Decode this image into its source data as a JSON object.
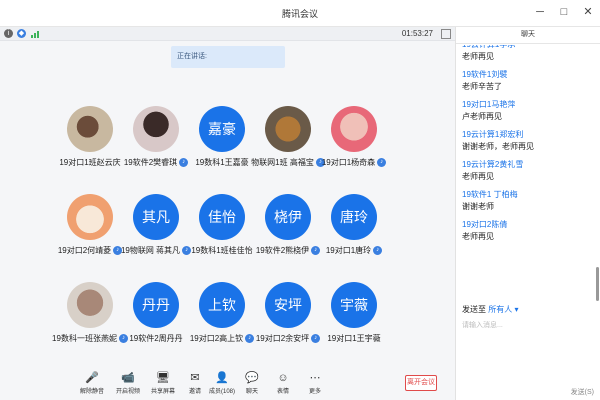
{
  "window": {
    "title": "腾讯会议",
    "controls": [
      "─",
      "□",
      "✕"
    ]
  },
  "infobar": {
    "timer": "01:53:27"
  },
  "speaking_label": "正在讲话:",
  "participants": [
    [
      {
        "name": "19对口1班赵云庆",
        "avatar": "",
        "photo": "p1",
        "mic": false
      },
      {
        "name": "19软件2樊睿琪",
        "avatar": "",
        "photo": "p2",
        "mic": true
      },
      {
        "name": "19数科1王嘉豪",
        "avatar": "嘉豪",
        "photo": "",
        "mic": false
      },
      {
        "name": "物联网1班 高福宝",
        "avatar": "",
        "photo": "p3",
        "mic": true
      },
      {
        "name": "19对口1杨奇森",
        "avatar": "",
        "photo": "p4",
        "mic": true
      }
    ],
    [
      {
        "name": "19对口2何靖菱",
        "avatar": "",
        "photo": "p5",
        "mic": true
      },
      {
        "name": "19物联网 蒋其凡",
        "avatar": "其凡",
        "photo": "",
        "mic": true
      },
      {
        "name": "19数科1班桂佳怡",
        "avatar": "佳怡",
        "photo": "",
        "mic": false
      },
      {
        "name": "19软件2熊桡伊",
        "avatar": "桡伊",
        "photo": "",
        "mic": true
      },
      {
        "name": "19对口1唐玲",
        "avatar": "唐玲",
        "photo": "",
        "mic": true
      }
    ],
    [
      {
        "name": "19数科一班张燕妮",
        "avatar": "",
        "photo": "p6",
        "mic": true
      },
      {
        "name": "19软件2周丹丹",
        "avatar": "丹丹",
        "photo": "",
        "mic": false
      },
      {
        "name": "19对口2高上钦",
        "avatar": "上钦",
        "photo": "",
        "mic": true
      },
      {
        "name": "19对口2余安坪",
        "avatar": "安坪",
        "photo": "",
        "mic": true
      },
      {
        "name": "19对口1王宇薇",
        "avatar": "宇薇",
        "photo": "",
        "mic": false
      }
    ]
  ],
  "toolbar": [
    {
      "icon": "🎤",
      "label": "解除静音",
      "name": "unmute"
    },
    {
      "icon": "📹",
      "label": "开启视频",
      "name": "start-video"
    },
    {
      "icon": "🖥",
      "label": "共享屏幕",
      "name": "share-screen"
    },
    {
      "icon": "✉",
      "label": "邀请",
      "name": "invite"
    },
    {
      "icon": "👤",
      "label": "成员(108)",
      "name": "members"
    },
    {
      "icon": "💬",
      "label": "聊天",
      "name": "chat"
    },
    {
      "icon": "☺",
      "label": "表情",
      "name": "reactions"
    },
    {
      "icon": "⋯",
      "label": "更多",
      "name": "more"
    }
  ],
  "leave_label": "离开会议",
  "chat": {
    "title": "聊天",
    "messages": [
      {
        "sender": "19云计算1李承",
        "text": "老师再见"
      },
      {
        "sender": "19软件1刘襞",
        "text": "老师辛苦了"
      },
      {
        "sender": "19对口1马艳萍",
        "text": "卢老师再见"
      },
      {
        "sender": "19云计算1郑宏利",
        "text": "谢谢老师，老师再见"
      },
      {
        "sender": "19云计算2黄礼雪",
        "text": "老师再见"
      },
      {
        "sender": "19软件1 丁柏梅",
        "text": "谢谢老师"
      },
      {
        "sender": "19对口2陈倩",
        "text": "老师再见"
      }
    ],
    "send_to_label": "发送至",
    "send_to_target": "所有人",
    "input_placeholder": "请输入消息...",
    "send_button": "发送(S)"
  }
}
